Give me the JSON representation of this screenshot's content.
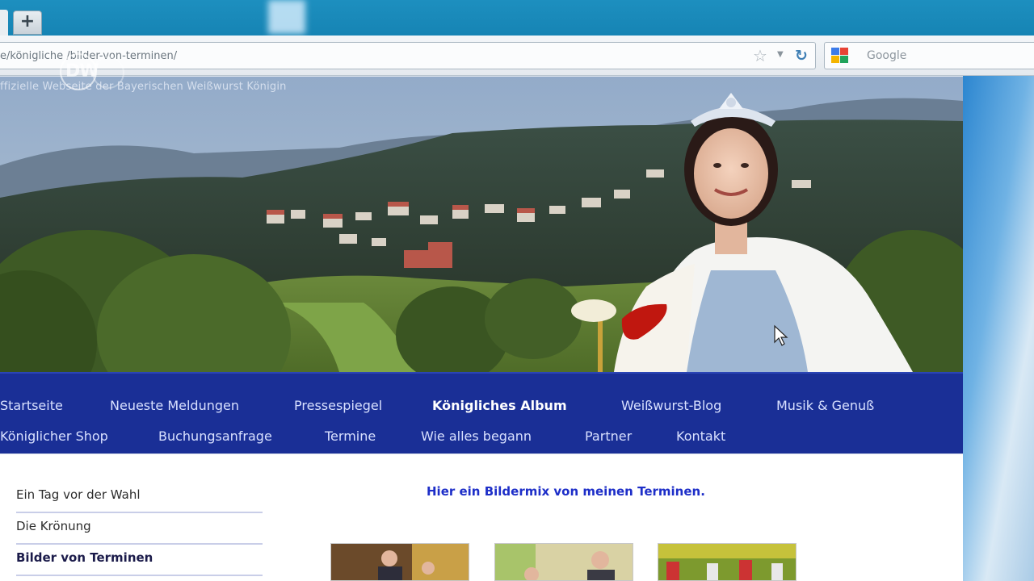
{
  "browser": {
    "new_tab_label": "+",
    "url": "e/königliche        /bilder-von-terminen/",
    "search_placeholder": "Google"
  },
  "watermark": {
    "text": "DW"
  },
  "site": {
    "tagline": "ffizielle Webseite der Bayerischen Weißwurst Königin"
  },
  "nav": {
    "row1": [
      {
        "label": "Startseite",
        "active": false
      },
      {
        "label": "Neueste Meldungen",
        "active": false
      },
      {
        "label": "Pressespiegel",
        "active": false
      },
      {
        "label": "Königliches Album",
        "active": true
      },
      {
        "label": "Weißwurst-Blog",
        "active": false
      },
      {
        "label": "Musik & Genuß",
        "active": false
      }
    ],
    "row2": [
      {
        "label": "Königlicher Shop",
        "active": false
      },
      {
        "label": "Buchungsanfrage",
        "active": false
      },
      {
        "label": "Termine",
        "active": false
      },
      {
        "label": "Wie alles begann",
        "active": false
      },
      {
        "label": "Partner",
        "active": false
      },
      {
        "label": "Kontakt",
        "active": false
      }
    ]
  },
  "subnav": [
    {
      "label": "Ein Tag vor der Wahl",
      "current": false
    },
    {
      "label": "Die Krönung",
      "current": false
    },
    {
      "label": "Bilder von Terminen",
      "current": true
    }
  ],
  "content": {
    "heading": "Hier ein Bildermix von meinen Terminen."
  },
  "colors": {
    "nav_bg": "#1a2f96",
    "heading": "#1d2ec8",
    "tabstrip": "#1684b4"
  }
}
